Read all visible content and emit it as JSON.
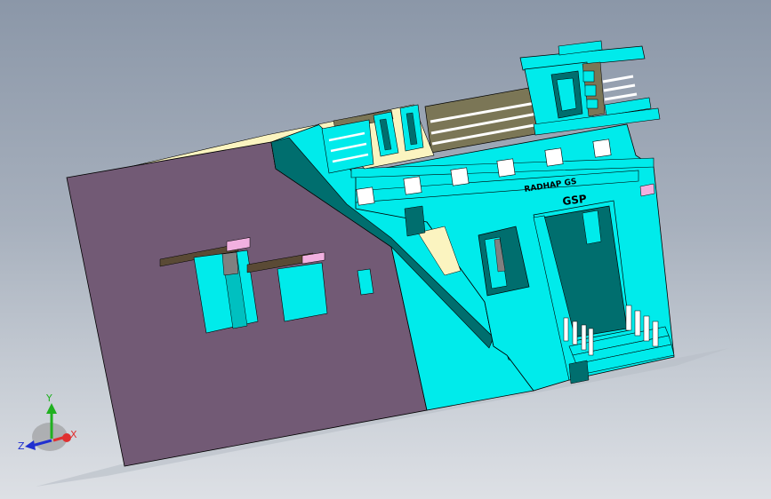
{
  "viewport": {
    "background_top": "#8b97a8",
    "background_bottom": "#dde0e5"
  },
  "model": {
    "colors": {
      "side_wall": "#725a75",
      "front_wall": "#00ebeb",
      "dark_teal": "#006e6e",
      "cream": "#fbf4c0",
      "olive": "#7b7656",
      "brown_beam": "#5a4a35",
      "pink": "#f2b0e0",
      "gray": "#808080",
      "white": "#ffffff"
    },
    "signboard_text": "RADHAP GS",
    "name_plate_text": "GSP"
  },
  "triad": {
    "x_label": "X",
    "y_label": "Y",
    "z_label": "Z",
    "x_color": "#e03030",
    "y_color": "#20b020",
    "z_color": "#2030d0"
  }
}
